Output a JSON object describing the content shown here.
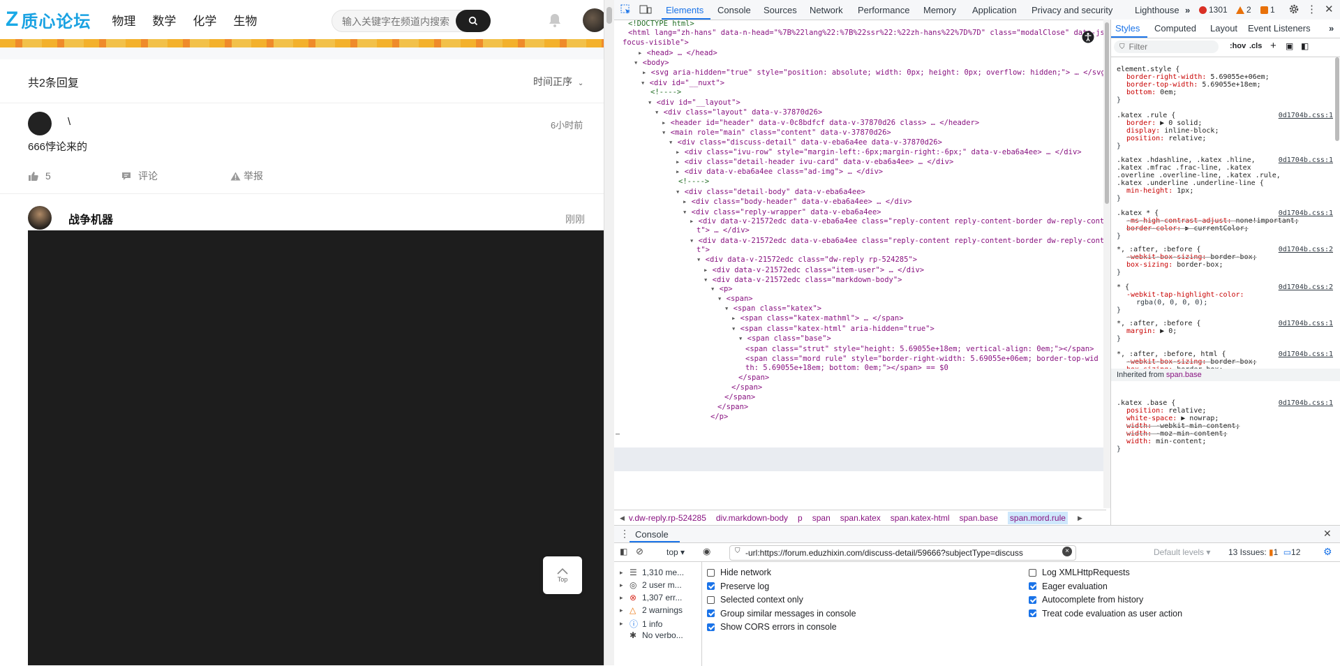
{
  "site": {
    "logo_mark": "Z",
    "logo_text": "质心论坛",
    "nav": [
      "物理",
      "数学",
      "化学",
      "生物"
    ],
    "search_placeholder": "输入关键字在频道内搜索"
  },
  "thread": {
    "reply_count": "共2条回复",
    "sort_label": "时间正序",
    "replies": [
      {
        "name": "\\",
        "time": "6小时前",
        "text": "666悖论来的",
        "likes": "5",
        "comment_label": "评论",
        "report_label": "举报"
      },
      {
        "name": "战争机器",
        "time": "刚刚"
      }
    ],
    "top_label": "Top"
  },
  "devtools": {
    "tabs": [
      "Elements",
      "Console",
      "Sources",
      "Network",
      "Performance",
      "Memory",
      "Application",
      "Privacy and security",
      "Lighthouse"
    ],
    "errors": "1301",
    "warnings": "2",
    "infos": "1",
    "dom_lines": [
      "<!DOCTYPE html>",
      "<html lang=\"zh-hans\" data-n-head=\"%7B%22lang%22:%7B%22ssr%22:%22zh-hans%22%7D%7D\" class=\"modalClose\" data-js-",
      "focus-visible\">",
      "<head> … </head>",
      "<body>",
      "<svg aria-hidden=\"true\" style=\"position: absolute; width: 0px; height: 0px; overflow: hidden;\"> … </svg>",
      "<div id=\"__nuxt\">",
      "<!---->",
      "<div id=\"__layout\">",
      "<div class=\"layout\" data-v-37870d26>",
      "<header id=\"header\" data-v-0c8bdfcf data-v-37870d26 class> … </header>",
      "<main role=\"main\" class=\"content\" data-v-37870d26>",
      "<div class=\"discuss-detail\" data-v-eba6a4ee data-v-37870d26>",
      "<div class=\"ivu-row\" style=\"margin-left:-6px;margin-right:-6px;\" data-v-eba6a4ee> … </div>",
      "<div class=\"detail-header ivu-card\" data-v-eba6a4ee> … </div>",
      "<div data-v-eba6a4ee class=\"ad-img\"> … </div>",
      "<!---->",
      "<div class=\"detail-body\" data-v-eba6a4ee>",
      "<div class=\"body-header\" data-v-eba6a4ee> … </div>",
      "<div class=\"reply-wrapper\" data-v-eba6a4ee>",
      "<div data-v-21572edc data-v-eba6a4ee class=\"reply-content reply-content-border dw-reply-conten",
      "t\"> … </div>",
      "<div data-v-21572edc data-v-eba6a4ee class=\"reply-content reply-content-border dw-reply-conten",
      "t\">",
      "<div data-v-21572edc class=\"dw-reply rp-524285\">",
      "<div data-v-21572edc class=\"item-user\"> … </div>",
      "<div data-v-21572edc class=\"markdown-body\">",
      "<p>",
      "<span>",
      "<span class=\"katex\">",
      "<span class=\"katex-mathml\"> … </span>",
      "<span class=\"katex-html\" aria-hidden=\"true\">",
      "<span class=\"base\">",
      "<span class=\"strut\" style=\"height: 5.69055e+18em; vertical-align: 0em;\"></span>",
      "<span class=\"mord rule\" style=\"border-right-width: 5.69055e+06em; border-top-wid",
      "th: 5.69055e+18em; bottom: 0em;\"></span> == $0",
      "</span>",
      "</span>",
      "</span>",
      "</span>",
      "</p>"
    ],
    "breadcrumbs": [
      "v.dw-reply.rp-524285",
      "div.markdown-body",
      "p",
      "span",
      "span.katex",
      "span.katex-html",
      "span.base",
      "span.mord.rule"
    ],
    "styles_tabs": [
      "Styles",
      "Computed",
      "Layout",
      "Event Listeners"
    ],
    "styles_filter": "Filter",
    "hov": ":hov",
    "cls": ".cls",
    "css_rules": [
      {
        "selector": "element.style {",
        "props": [
          "border-right-width: 5.69055e+06em;",
          "border-top-width: 5.69055e+18em;",
          "bottom: 0em;"
        ]
      },
      {
        "selector": ".katex .rule {",
        "source": "0d1704b.css:1",
        "props": [
          "border: ▶ 0 solid;",
          "display: inline-block;",
          "position: relative;"
        ]
      },
      {
        "selector": ".katex .hdashline, .katex .hline, .katex .mfrac .frac-line, .katex .overline .overline-line, .katex .rule, .katex .underline .underline-line {",
        "source": "0d1704b.css:1",
        "props": [
          "min-height: 1px;"
        ]
      },
      {
        "selector": ".katex * {",
        "source": "0d1704b.css:1",
        "props": [
          "-ms-high-contrast-adjust: none!important;",
          "border-color: ▶ currentColor;"
        ]
      },
      {
        "selector": "*, :after, :before {",
        "source": "0d1704b.css:2",
        "props": [
          "-webkit-box-sizing: border-box;",
          "box-sizing: border-box;"
        ]
      },
      {
        "selector": "* {",
        "source": "0d1704b.css:2",
        "props": [
          "-webkit-tap-highlight-color:",
          "rgba(0, 0, 0, 0);"
        ]
      },
      {
        "selector": "*, :after, :before {",
        "source": "0d1704b.css:1",
        "props": [
          "margin: ▶ 0;"
        ]
      },
      {
        "selector": "*, :after, :before, html {",
        "source": "0d1704b.css:1",
        "props": [
          "-webkit-box-sizing: border-box;",
          "box-sizing: border-box;"
        ]
      },
      {
        "selector": ".katex .base {",
        "source": "0d1704b.css:1",
        "props": [
          "position: relative;",
          "white-space: ▶ nowrap;",
          "width: -webkit-min-content;",
          "width: -moz-min-content;",
          "width: min-content;"
        ]
      }
    ],
    "inherited_label": "Inherited from ",
    "inherited_selector": "span.base",
    "drawer_tab": "Console",
    "context": "top ▾",
    "console_filter": "-url:https://forum.eduzhixin.com/discuss-detail/59666?subjectType=discuss",
    "default_levels": "Default levels ▾",
    "issues_label": "13 Issues:",
    "issues_warn": "1",
    "issues_info": "12",
    "sidebar": [
      {
        "label": "1,310 me...",
        "icon": "list-icon"
      },
      {
        "label": "2 user m...",
        "icon": "user-icon"
      },
      {
        "label": "1,307 err...",
        "icon": "error-icon"
      },
      {
        "label": "2 warnings",
        "icon": "warning-icon"
      },
      {
        "label": "1 info",
        "icon": "info-icon"
      },
      {
        "label": "No verbo...",
        "icon": "bug-icon"
      }
    ],
    "options_left": [
      {
        "label": "Hide network",
        "checked": false
      },
      {
        "label": "Preserve log",
        "checked": true
      },
      {
        "label": "Selected context only",
        "checked": false
      },
      {
        "label": "Group similar messages in console",
        "checked": true
      },
      {
        "label": "Show CORS errors in console",
        "checked": true
      }
    ],
    "options_right": [
      {
        "label": "Log XMLHttpRequests",
        "checked": false
      },
      {
        "label": "Eager evaluation",
        "checked": true
      },
      {
        "label": "Autocomplete from history",
        "checked": true
      },
      {
        "label": "Treat code evaluation as user action",
        "checked": true
      }
    ]
  }
}
